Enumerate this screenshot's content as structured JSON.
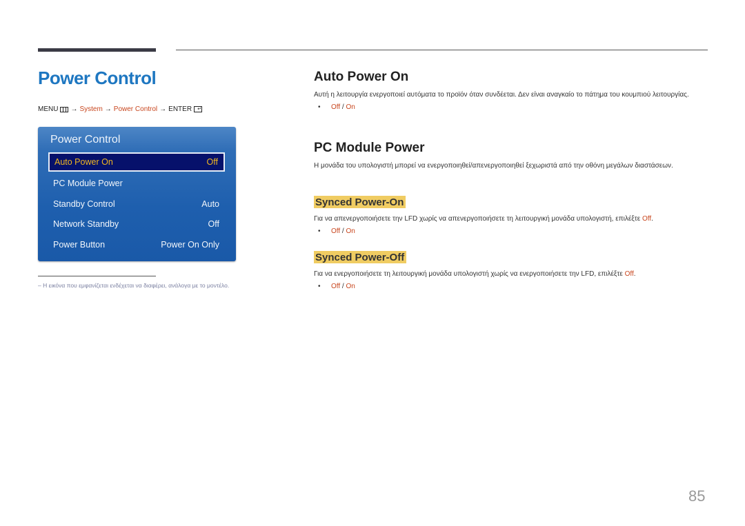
{
  "page": {
    "title": "Power Control",
    "page_number": "85"
  },
  "breadcrumb": {
    "menu": "MENU",
    "menu_icon": "menu-grid-icon",
    "arrow": "→",
    "system": "System",
    "power_control": "Power Control",
    "enter": "ENTER",
    "enter_icon": "enter-icon"
  },
  "osd_menu": {
    "title": "Power Control",
    "items": [
      {
        "label": "Auto Power On",
        "value": "Off",
        "selected": true
      },
      {
        "label": "PC Module Power",
        "value": ""
      },
      {
        "label": "Standby Control",
        "value": "Auto"
      },
      {
        "label": "Network Standby",
        "value": "Off"
      },
      {
        "label": "Power Button",
        "value": "Power On Only"
      }
    ]
  },
  "footnote": "–  Η εικόνα που εμφανίζεται ενδέχεται να διαφέρει, ανάλογα με το μοντέλο.",
  "sections": {
    "auto_power_on": {
      "heading": "Auto Power On",
      "body": "Αυτή η λειτουργία ενεργοποιεί αυτόματα το προϊόν όταν συνδέεται. Δεν είναι αναγκαίο το πάτημα του κουμπιού λειτουργίας.",
      "options": {
        "off": "Off",
        "sep": " / ",
        "on": "On"
      }
    },
    "pc_module_power": {
      "heading": "PC Module Power",
      "body": "Η μονάδα του υπολογιστή μπορεί να ενεργοποιηθεί/απενεργοποιηθεί ξεχωριστά από την οθόνη μεγάλων διαστάσεων."
    },
    "synced_power_on": {
      "heading": "Synced Power-On",
      "body": "Για να απενεργοποιήσετε την LFD χωρίς να απενεργοποιήσετε τη λειτουργική μονάδα υπολογιστή, επιλέξτε ",
      "body_accent": "Off",
      "body_end": ".",
      "options": {
        "off": "Off",
        "sep": " / ",
        "on": "On"
      }
    },
    "synced_power_off": {
      "heading": "Synced Power-Off",
      "body": "Για να ενεργοποιήσετε τη λειτουργική μονάδα υπολογιστή χωρίς να ενεργοποιήσετε την LFD, επιλέξτε ",
      "body_accent": "Off",
      "body_end": ".",
      "options": {
        "off": "Off",
        "sep": " / ",
        "on": "On"
      }
    },
    "bullet": "•"
  },
  "colors": {
    "title_blue": "#1e77c1",
    "accent_orange": "#c8461e",
    "highlight_yellow": "#f0cc62",
    "osd_blue": "#1e5fae",
    "osd_selected": "#06116b",
    "osd_selected_text": "#f1b721"
  }
}
